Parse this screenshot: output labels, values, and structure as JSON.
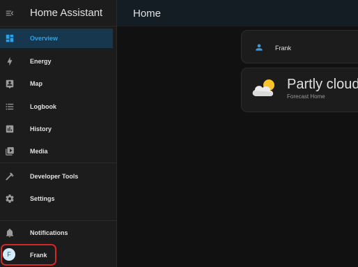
{
  "app": {
    "title": "Home Assistant"
  },
  "header": {
    "title": "Home"
  },
  "sidebar": {
    "items": [
      {
        "label": "Overview",
        "icon": "view-dashboard-icon",
        "active": true
      },
      {
        "label": "Energy",
        "icon": "lightning-bolt-icon"
      },
      {
        "label": "Map",
        "icon": "map-account-icon"
      },
      {
        "label": "Logbook",
        "icon": "format-list-bulleted-icon"
      },
      {
        "label": "History",
        "icon": "chart-box-icon"
      },
      {
        "label": "Media",
        "icon": "play-box-multiple-icon"
      },
      {
        "label": "Developer Tools",
        "icon": "hammer-icon"
      },
      {
        "label": "Settings",
        "icon": "cog-icon"
      }
    ],
    "notifications_label": "Notifications",
    "user": {
      "initial": "F",
      "name": "Frank"
    }
  },
  "cards": {
    "person": {
      "name": "Frank",
      "icon": "account-icon"
    },
    "weather": {
      "condition": "Partly cloudy",
      "source": "Forecast Home",
      "icon": "partly-cloudy-icon"
    }
  },
  "colors": {
    "accent": "#27a4ee",
    "active_bg": "#16374d",
    "highlight": "#d32828"
  }
}
